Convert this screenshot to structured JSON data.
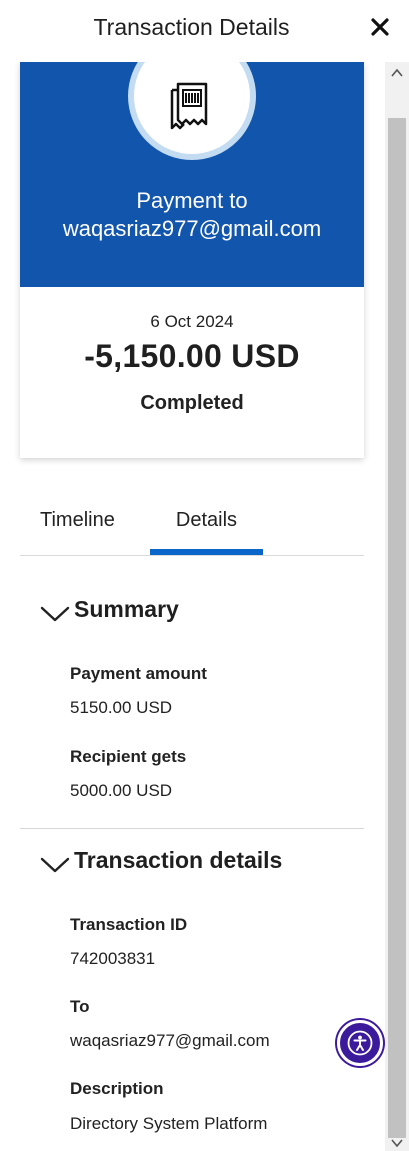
{
  "header": {
    "title": "Transaction Details"
  },
  "card": {
    "payment_to": "Payment to",
    "recipient": "waqasriaz977@gmail.com",
    "date": "6 Oct 2024",
    "amount": "-5,150.00 USD",
    "status": "Completed",
    "accent_color": "#1255ad"
  },
  "tabs": [
    {
      "label": "Timeline",
      "active": false
    },
    {
      "label": "Details",
      "active": true
    }
  ],
  "summary": {
    "title": "Summary",
    "fields": [
      {
        "label": "Payment amount",
        "value": "5150.00 USD"
      },
      {
        "label": "Recipient gets",
        "value": "5000.00 USD"
      }
    ]
  },
  "transaction_details": {
    "title": "Transaction details",
    "fields": [
      {
        "label": "Transaction ID",
        "value": "742003831"
      },
      {
        "label": "To",
        "value": "waqasriaz977@gmail.com"
      },
      {
        "label": "Description",
        "value": "Directory System Platform"
      }
    ]
  },
  "icons": {
    "close": "close-icon",
    "receipt": "receipt-icon",
    "chevron": "chevron-down-icon",
    "accessibility": "accessibility-icon"
  },
  "colors": {
    "tab_active": "#0a66c9",
    "accessibility": "#3c1a9c"
  }
}
